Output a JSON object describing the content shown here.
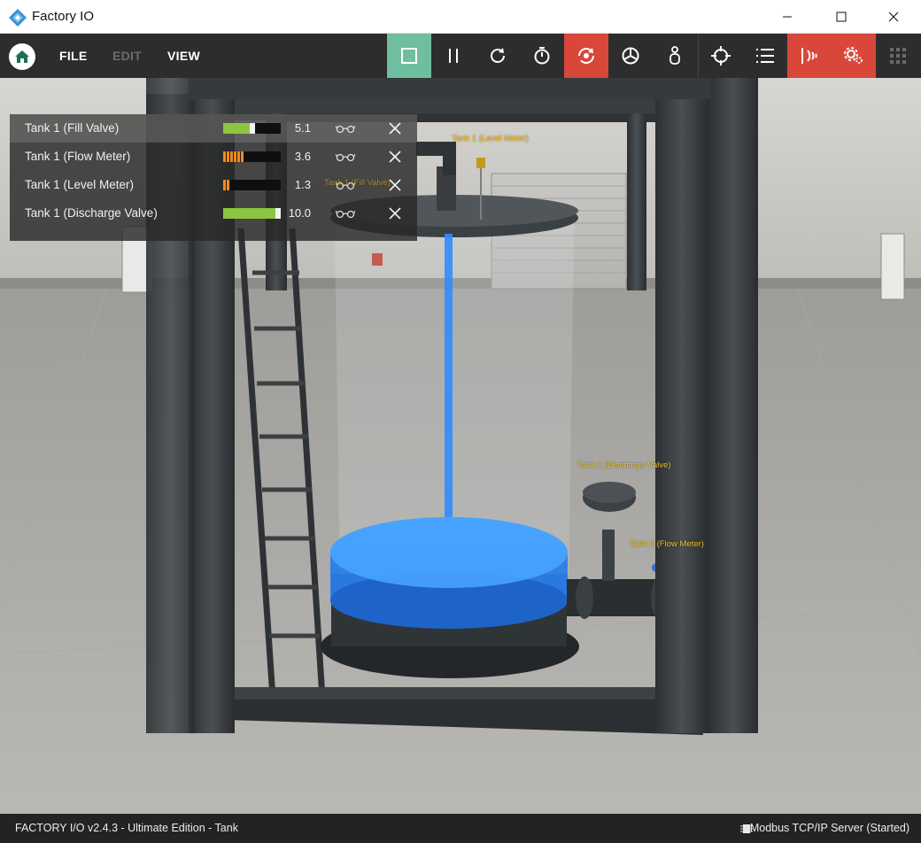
{
  "window": {
    "title": "Factory IO"
  },
  "menu": {
    "file": "FILE",
    "edit": "EDIT",
    "view": "VIEW"
  },
  "toolbar": {
    "tools": [
      {
        "icon": "stop-icon",
        "state": "active-green"
      },
      {
        "icon": "pause-icon"
      },
      {
        "icon": "reset-icon"
      },
      {
        "icon": "timer-icon"
      },
      {
        "icon": "camera-orbit-icon",
        "state": "active-red"
      },
      {
        "icon": "fly-camera-icon"
      },
      {
        "icon": "first-person-icon"
      },
      {
        "icon": "target-icon"
      },
      {
        "icon": "list-icon"
      },
      {
        "icon": "sensors-icon",
        "state": "active-red"
      },
      {
        "icon": "settings-icon"
      },
      {
        "icon": "grid-icon",
        "state": "disabled"
      }
    ],
    "colors": {
      "green": "#6fbea0",
      "red": "#d9473b"
    }
  },
  "panel": {
    "rows": [
      {
        "label": "Tank 1 (Fill Valve)",
        "value": "5.1",
        "type": "slider",
        "level": 0.51
      },
      {
        "label": "Tank 1 (Flow Meter)",
        "value": "3.6",
        "type": "meter",
        "level": 0.36
      },
      {
        "label": "Tank 1 (Level Meter)",
        "value": "1.3",
        "type": "meter",
        "level": 0.13
      },
      {
        "label": "Tank 1 (Discharge Valve)",
        "value": "10.0",
        "type": "slider",
        "level": 1.0
      }
    ]
  },
  "scene": {
    "tags": {
      "level_meter": "Tank 1 (Level Meter)",
      "fill_valve": "Tank 1 (Fill Valve)",
      "discharge_valve": "Tank 1 (Discharge Valve)",
      "flow_meter": "Tank 1 (Flow Meter)"
    },
    "water_color": "#2f8dff"
  },
  "status": {
    "left": "FACTORY I/O v2.4.3 - Ultimate Edition - Tank",
    "right": "Modbus TCP/IP Server (Started)"
  }
}
